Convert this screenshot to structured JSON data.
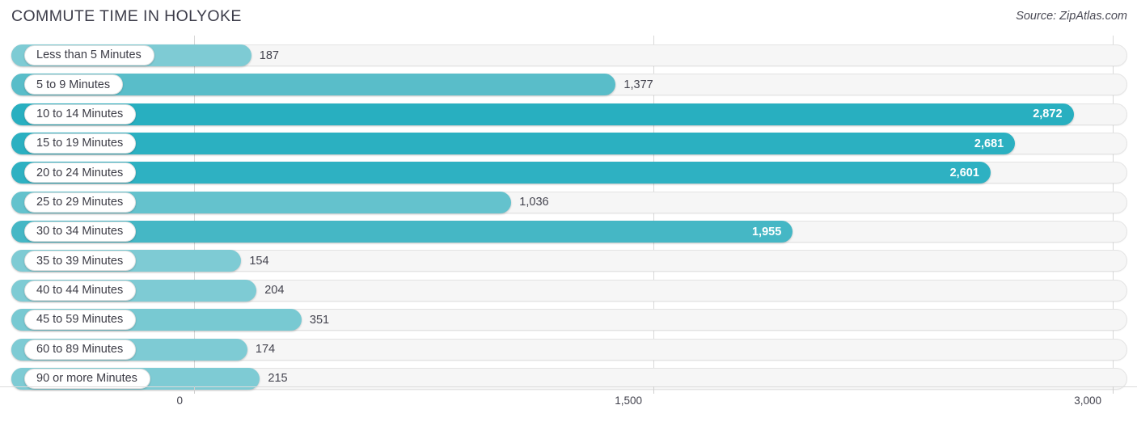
{
  "header": {
    "title": "COMMUTE TIME IN HOLYOKE",
    "source": "Source: ZipAtlas.com"
  },
  "axis": {
    "ticks": [
      "0",
      "1,500",
      "3,000"
    ],
    "tick_values": [
      0,
      1500,
      3000
    ]
  },
  "colors": {
    "bar_light": "#7ecbd4",
    "bar_mid": "#57bcc8",
    "bar_dark": "#28afc0",
    "track": "#f6f6f6",
    "pill": "#ffffff",
    "text": "#3c3c46",
    "gridline": "#d8d8d8"
  },
  "chart_data": {
    "type": "bar",
    "orientation": "horizontal",
    "title": "COMMUTE TIME IN HOLYOKE",
    "subtitle": "",
    "xlabel": "",
    "ylabel": "",
    "xlim": [
      0,
      3000
    ],
    "grid": true,
    "legend": null,
    "source": "Source: ZipAtlas.com",
    "categories": [
      "Less than 5 Minutes",
      "5 to 9 Minutes",
      "10 to 14 Minutes",
      "15 to 19 Minutes",
      "20 to 24 Minutes",
      "25 to 29 Minutes",
      "30 to 34 Minutes",
      "35 to 39 Minutes",
      "40 to 44 Minutes",
      "45 to 59 Minutes",
      "60 to 89 Minutes",
      "90 or more Minutes"
    ],
    "values": [
      187,
      1377,
      2872,
      2681,
      2601,
      1036,
      1955,
      154,
      204,
      351,
      174,
      215
    ],
    "value_labels": [
      "187",
      "1,377",
      "2,872",
      "2,681",
      "2,601",
      "1,036",
      "1,955",
      "154",
      "204",
      "351",
      "174",
      "215"
    ],
    "bars": [
      {
        "label": "Less than 5 Minutes",
        "value": 187,
        "value_label": "187",
        "color": "#7ecbd4",
        "label_inside": false
      },
      {
        "label": "5 to 9 Minutes",
        "value": 1377,
        "value_label": "1,377",
        "color": "#59bdc9",
        "label_inside": false
      },
      {
        "label": "10 to 14 Minutes",
        "value": 2872,
        "value_label": "2,872",
        "color": "#28afc0",
        "label_inside": true
      },
      {
        "label": "15 to 19 Minutes",
        "value": 2681,
        "value_label": "2,681",
        "color": "#2bb0c1",
        "label_inside": true
      },
      {
        "label": "20 to 24 Minutes",
        "value": 2601,
        "value_label": "2,601",
        "color": "#2eb1c2",
        "label_inside": true
      },
      {
        "label": "25 to 29 Minutes",
        "value": 1036,
        "value_label": "1,036",
        "color": "#64c2cd",
        "label_inside": false
      },
      {
        "label": "30 to 34 Minutes",
        "value": 1955,
        "value_label": "1,955",
        "color": "#45b7c5",
        "label_inside": true
      },
      {
        "label": "35 to 39 Minutes",
        "value": 154,
        "value_label": "154",
        "color": "#7ecbd4",
        "label_inside": false
      },
      {
        "label": "40 to 44 Minutes",
        "value": 204,
        "value_label": "204",
        "color": "#7ecbd4",
        "label_inside": false
      },
      {
        "label": "45 to 59 Minutes",
        "value": 351,
        "value_label": "351",
        "color": "#78c9d2",
        "label_inside": false
      },
      {
        "label": "60 to 89 Minutes",
        "value": 174,
        "value_label": "174",
        "color": "#7ecbd4",
        "label_inside": false
      },
      {
        "label": "90 or more Minutes",
        "value": 215,
        "value_label": "215",
        "color": "#7ecbd4",
        "label_inside": false
      }
    ]
  }
}
